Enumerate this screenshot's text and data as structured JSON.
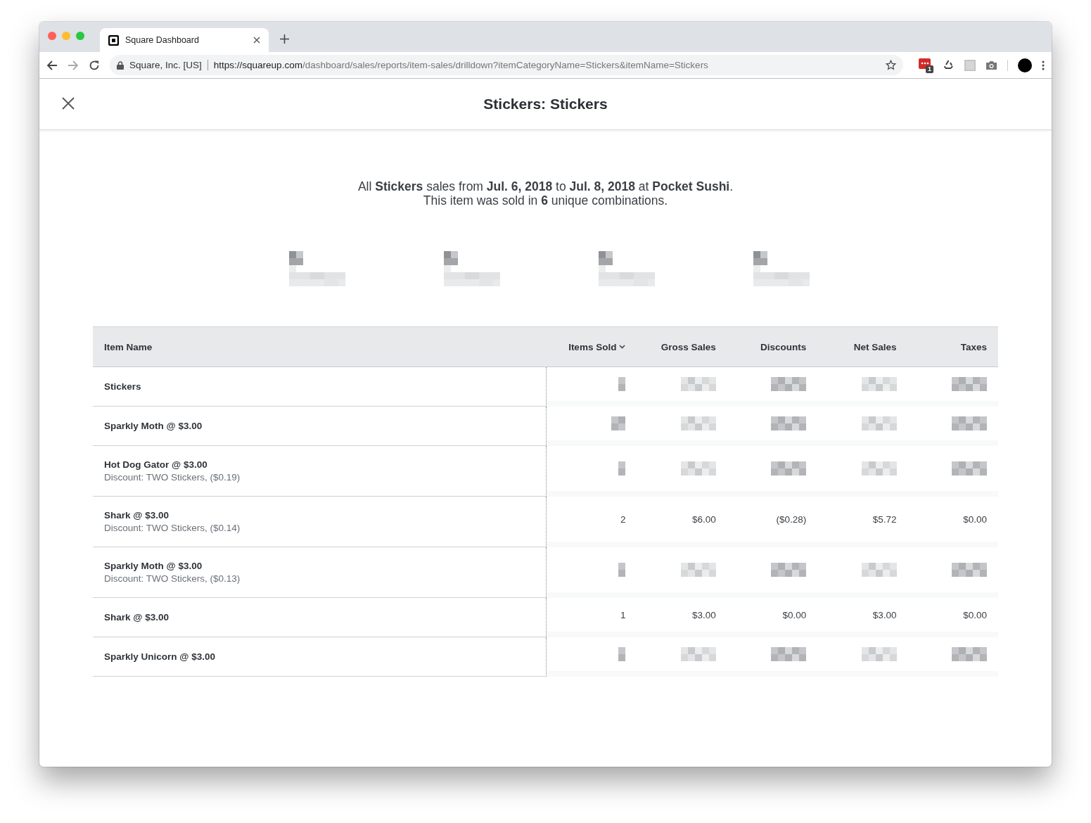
{
  "browser": {
    "tab_title": "Square Dashboard",
    "address_owner": "Square, Inc. [US]",
    "url_host": "https://squareup.com",
    "url_path": "/dashboard/sales/reports/item-sales/drilldown?itemCategoryName=Stickers&itemName=Stickers",
    "extension_badge": "1"
  },
  "header": {
    "title": "Stickers: Stickers"
  },
  "summary": {
    "line_1": "All **Stickers** sales from **Jul. 6, 2018** to **Jul. 8, 2018** at **Pocket Sushi**.",
    "line_2": "This item was sold in **6** unique combinations."
  },
  "summary_tiles": [
    {
      "redacted": true
    },
    {
      "redacted": true
    },
    {
      "redacted": true
    },
    {
      "redacted": true
    }
  ],
  "table": {
    "columns": [
      {
        "label": "Item Name",
        "sorted": false
      },
      {
        "label": "Items Sold",
        "sorted": true
      },
      {
        "label": "Gross Sales",
        "sorted": false
      },
      {
        "label": "Discounts",
        "sorted": false
      },
      {
        "label": "Net Sales",
        "sorted": false
      },
      {
        "label": "Taxes",
        "sorted": false
      }
    ],
    "rows": [
      {
        "name": "Stickers",
        "redacted": true
      },
      {
        "name": "Sparkly Moth @ $3.00",
        "redacted": true
      },
      {
        "name": "Hot Dog Gator @ $3.00",
        "discount": "Discount: TWO Stickers, ($0.19)",
        "redacted": true
      },
      {
        "name": "Shark @ $3.00",
        "discount": "Discount: TWO Stickers, ($0.14)",
        "redacted": false,
        "values": [
          "2",
          "$6.00",
          "($0.28)",
          "$5.72",
          "$0.00"
        ]
      },
      {
        "name": "Sparkly Moth @ $3.00",
        "discount": "Discount: TWO Stickers, ($0.13)",
        "redacted": true
      },
      {
        "name": "Shark @ $3.00",
        "redacted": false,
        "values": [
          "1",
          "$3.00",
          "$0.00",
          "$3.00",
          "$0.00"
        ]
      },
      {
        "name": "Sparkly Unicorn @ $3.00",
        "redacted": true
      }
    ]
  }
}
